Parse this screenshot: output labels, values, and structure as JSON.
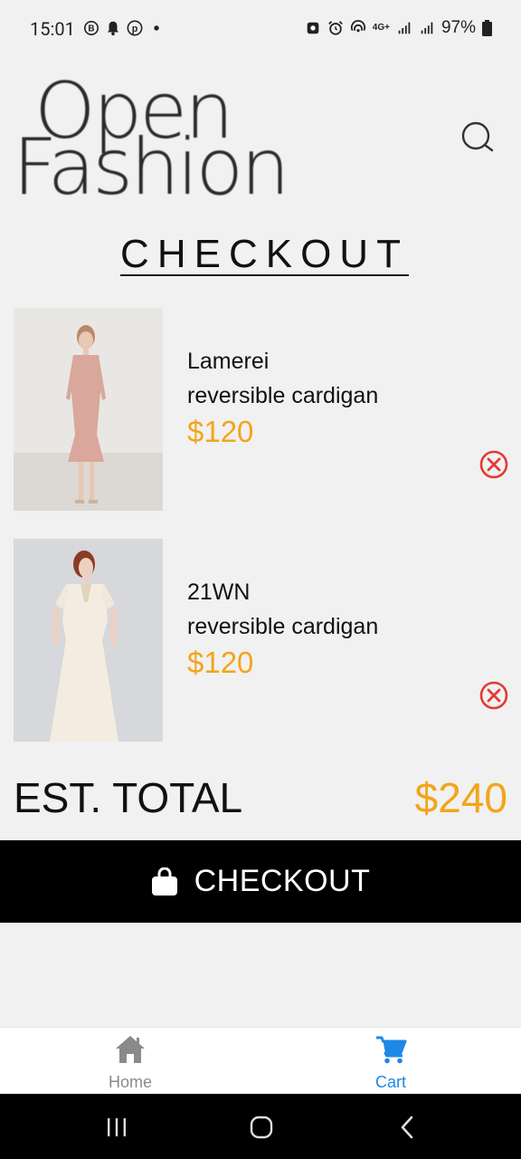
{
  "status_bar": {
    "time": "15:01",
    "battery": "97%",
    "network": "4G+"
  },
  "brand": {
    "logo_line1": "Open",
    "logo_line2": "Fashion"
  },
  "page": {
    "title": "CHECKOUT"
  },
  "cart": {
    "items": [
      {
        "name_line1": "Lamerei",
        "name_line2": "reversible cardigan",
        "price": "$120"
      },
      {
        "name_line1": "21WN",
        "name_line2": "reversible cardigan",
        "price": "$120"
      }
    ],
    "total_label": "EST. TOTAL",
    "total_value": "$240"
  },
  "checkout_button": {
    "label": "CHECKOUT",
    "icon": "shopping-bag-icon"
  },
  "bottom_nav": {
    "items": [
      {
        "label": "Home",
        "icon": "home-icon",
        "active": false
      },
      {
        "label": "Cart",
        "icon": "cart-icon",
        "active": true
      }
    ]
  },
  "colors": {
    "accent": "#f3a51a",
    "active_nav": "#1e88e5",
    "inactive_nav": "#8a8a8a",
    "remove": "#e53935"
  }
}
